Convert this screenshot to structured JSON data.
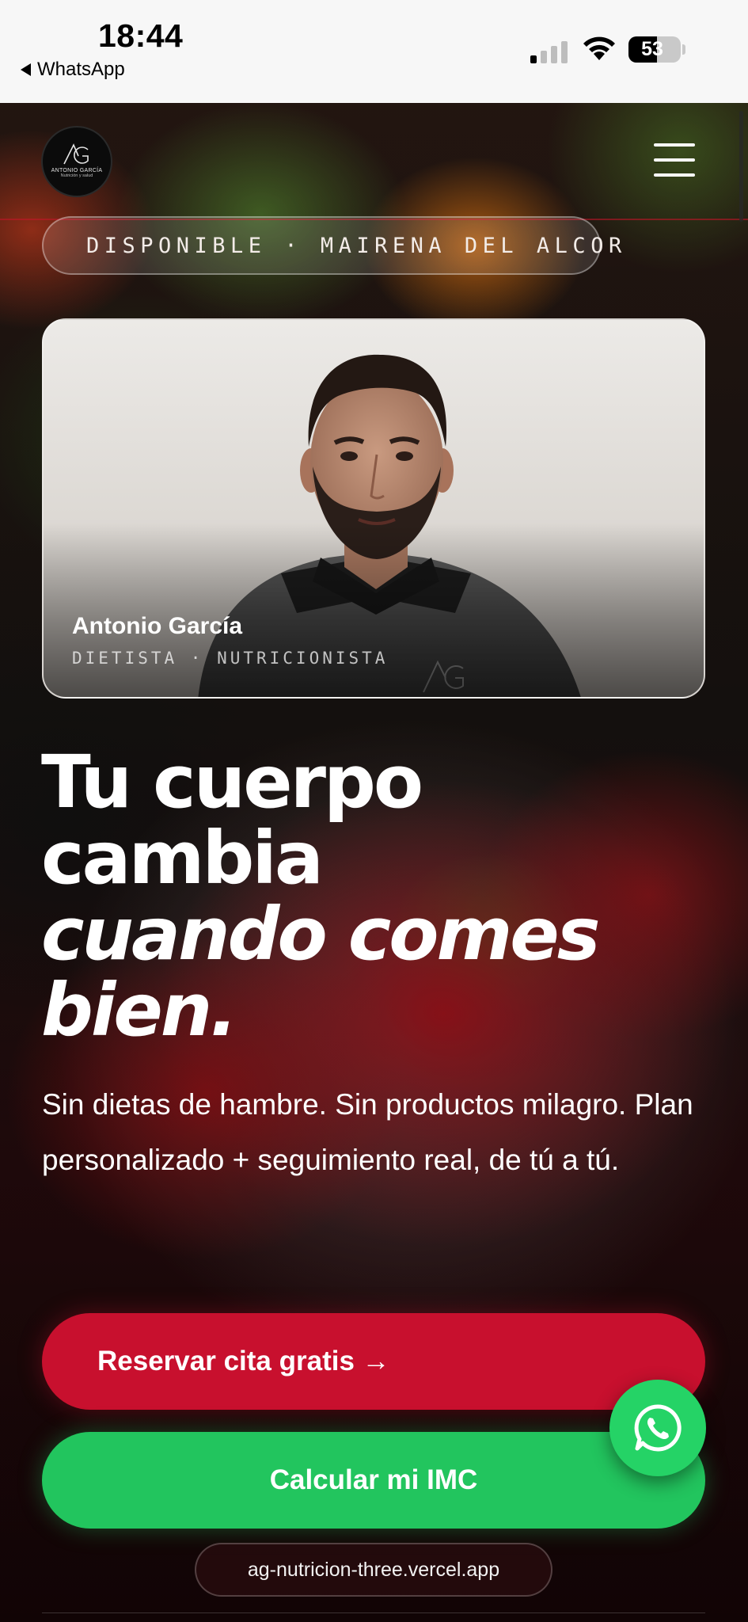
{
  "status_bar": {
    "time": "18:44",
    "back_label": "WhatsApp",
    "battery": "53",
    "signal_bars_active": 1,
    "signal_bars_total": 4
  },
  "header": {
    "logo": {
      "name": "ANTONIO GARCÍA",
      "subtitle": "Nutrición y salud"
    },
    "menu_icon": "hamburger-menu-icon"
  },
  "availability": {
    "status": "DISPONIBLE",
    "separator": "·",
    "location": "MAIRENA DEL ALCOR",
    "dot_color": "#e11d36"
  },
  "profile": {
    "name": "Antonio García",
    "role": "DIETISTA · NUTRICIONISTA"
  },
  "hero": {
    "headline_line1": "Tu cuerpo",
    "headline_line2": "cambia",
    "headline_italic_line1": "cuando comes",
    "headline_italic_line2": "bien.",
    "subtitle": "Sin dietas de hambre. Sin productos milagro. Plan personalizado + seguimiento real, de tú a tú."
  },
  "actions": {
    "primary_label": "Reservar cita gratis →",
    "secondary_label": "Calcular mi IMC",
    "fab_icon": "whatsapp-icon"
  },
  "browser": {
    "url": "ag-nutricion-three.vercel.app"
  },
  "colors": {
    "primary": "#c8102e",
    "secondary": "#22c55e",
    "whatsapp": "#25d366"
  }
}
